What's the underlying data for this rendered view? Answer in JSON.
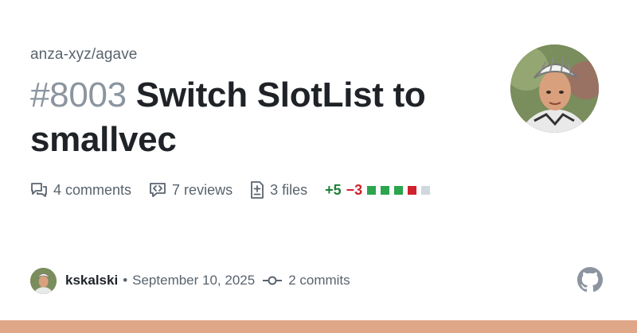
{
  "repo": "anza-xyz/agave",
  "pr": {
    "number": "#8003",
    "title": "Switch SlotList to smallvec"
  },
  "stats": {
    "comments": "4 comments",
    "reviews": "7 reviews",
    "files": "3 files",
    "additions": "+5",
    "deletions": "−3",
    "diff_blocks": [
      "#2da44e",
      "#2da44e",
      "#2da44e",
      "#cf222e",
      "#d0d7de"
    ]
  },
  "footer": {
    "author": "kskalski",
    "separator": "•",
    "date": "September 10, 2025",
    "commits": "2 commits"
  },
  "colors": {
    "accent_bar": "#dfa787",
    "additions": "#1a7f37",
    "deletions": "#cf222e"
  }
}
